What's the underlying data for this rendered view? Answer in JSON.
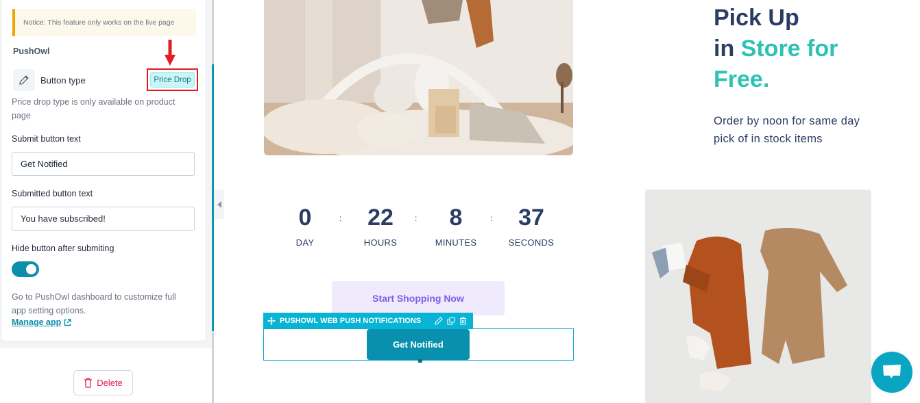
{
  "sidebar": {
    "notice": "Notice: This feature only works on the live page",
    "section_title": "PushOwl",
    "button_type": {
      "label": "Button type",
      "value": "Price Drop",
      "help": "Price drop type is only available on product page"
    },
    "submit_text": {
      "label": "Submit button text",
      "value": "Get Notified"
    },
    "submitted_text": {
      "label": "Submitted button text",
      "value": "You have subscribed!"
    },
    "hide_after_submit": {
      "label": "Hide button after submiting",
      "enabled": true
    },
    "dashboard_text": "Go to PushOwl dashboard to customize full app setting options.",
    "manage_link": "Manage app",
    "delete_label": "Delete"
  },
  "canvas": {
    "headline": {
      "line1": "Pick Up",
      "line2_dark": "in",
      "line2_accent": "Store for",
      "line3_accent": "Free."
    },
    "subline": "Order by noon for same day pick of in stock items",
    "countdown": [
      {
        "value": "0",
        "label": "DAY"
      },
      {
        "value": "22",
        "label": "HOURS"
      },
      {
        "value": "8",
        "label": "MINUTES"
      },
      {
        "value": "37",
        "label": "SECONDS"
      }
    ],
    "separator": ":",
    "shop_button": "Start Shopping Now",
    "widget": {
      "title": "PUSHOWL WEB PUSH NOTIFICATIONS",
      "button": "Get Notified"
    }
  },
  "colors": {
    "accent_teal": "#0b8fab",
    "headline_dark": "#2b3d63",
    "headline_accent": "#2ec2b2",
    "highlight_red": "#e31b23",
    "shop_button_text": "#7a5ee8"
  }
}
